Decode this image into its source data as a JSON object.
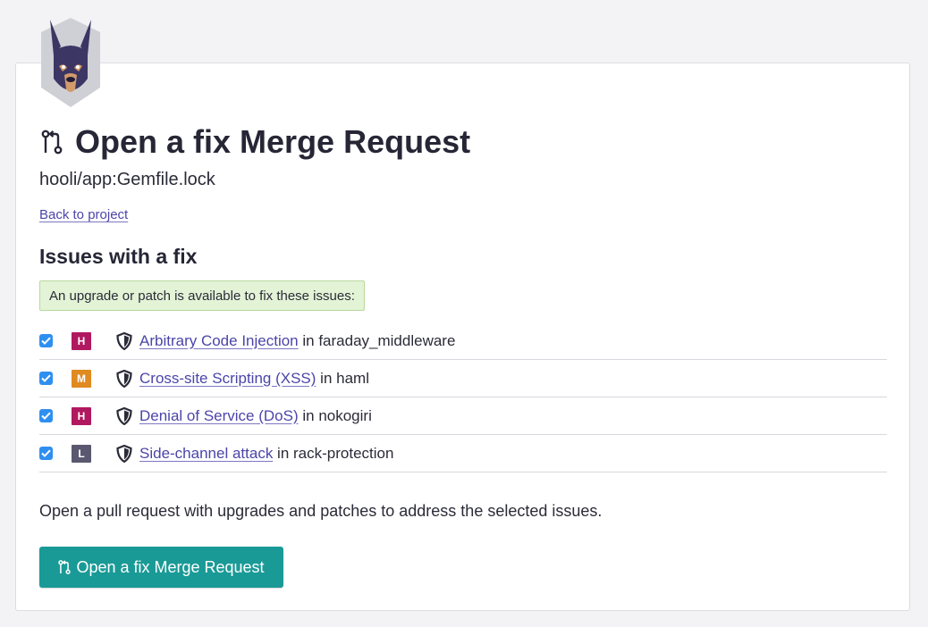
{
  "page": {
    "title": "Open a fix Merge Request",
    "subtitle": "hooli/app:Gemfile.lock",
    "back_link": "Back to project"
  },
  "issues_section": {
    "title": "Issues with a fix",
    "notice": "An upgrade or patch is available to fix these issues:",
    "connector": " in ",
    "items": [
      {
        "severity": "H",
        "severity_color": "#b0195f",
        "name": "Arbitrary Code Injection",
        "package": "faraday_middleware",
        "checked": true
      },
      {
        "severity": "M",
        "severity_color": "#e08a1f",
        "name": "Cross-site Scripting (XSS)",
        "package": "haml",
        "checked": true
      },
      {
        "severity": "H",
        "severity_color": "#b0195f",
        "name": "Denial of Service (DoS)",
        "package": "nokogiri",
        "checked": true
      },
      {
        "severity": "L",
        "severity_color": "#5a5870",
        "name": "Side-channel attack",
        "package": "rack-protection",
        "checked": true
      }
    ]
  },
  "footer": {
    "description": "Open a pull request with upgrades and patches to address the selected issues.",
    "button_label": "Open a fix Merge Request"
  },
  "colors": {
    "accent": "#1a9a96",
    "link": "#4b45a9",
    "checkbox": "#2f8ff0",
    "notice_bg": "#e3f3d6"
  },
  "icons": {
    "logo": "doberman-logo",
    "title": "merge-request-icon",
    "issue": "shield-icon",
    "checkbox": "check-icon"
  }
}
